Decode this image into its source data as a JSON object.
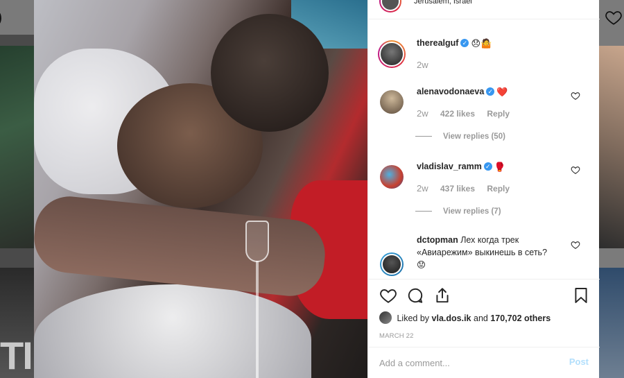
{
  "post": {
    "location": "Jerusalem, Israel",
    "caption_user": "therealguf",
    "caption_emojis": "😞🤷",
    "caption_time": "2w"
  },
  "comments": [
    {
      "username": "alenavodonaeva",
      "emoji": "❤️",
      "time": "2w",
      "likes": "422 likes",
      "reply": "Reply",
      "view_replies": "View replies (50)"
    },
    {
      "username": "vladislav_ramm",
      "emoji": "🥊",
      "time": "2w",
      "likes": "437 likes",
      "reply": "Reply",
      "view_replies": "View replies (7)"
    },
    {
      "username": "dctopman",
      "text_line1": "Лех когда трек",
      "text_line2": "«Авиарежим» выкинешь в сеть?",
      "text_line3": "😟"
    }
  ],
  "liked_by": {
    "prefix": "Liked by",
    "user": "vla.dos.ik",
    "middle": "and",
    "count": "170,702 others"
  },
  "date": "MARCH 22",
  "add_comment": {
    "placeholder": "Add a comment...",
    "post_label": "Post"
  },
  "icons": {
    "like": "heart-icon",
    "comment": "comment-icon",
    "share": "share-icon",
    "save": "bookmark-icon"
  },
  "colors": {
    "verified": "#3897f0",
    "post_button": "#b2dffc",
    "liked_heart": "#ed4956"
  }
}
